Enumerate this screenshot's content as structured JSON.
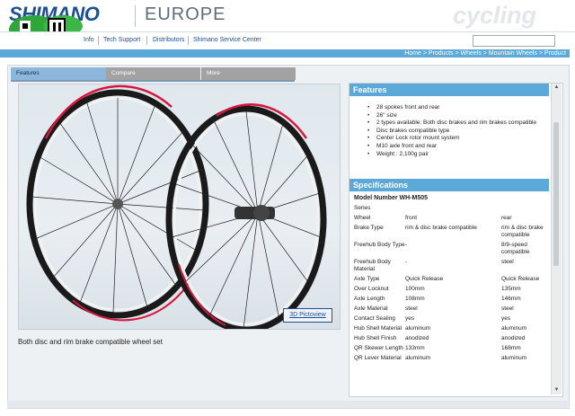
{
  "header": {
    "logo": "SHIMANO",
    "region": "EUROPE",
    "watermark": "cycling"
  },
  "nav": {
    "items": [
      "Info",
      "Tech Support",
      "Distributors",
      "Shimano Service Center"
    ],
    "search_placeholder": ""
  },
  "breadcrumb": "Home > Products > Wheels > Mountain Wheels > Product",
  "tabs": [
    {
      "label": "Features",
      "active": true
    },
    {
      "label": "Compare",
      "active": false
    },
    {
      "label": "More",
      "active": false
    }
  ],
  "image": {
    "pictoview_label": "3D Pictoview",
    "caption": "Both disc and rim brake compatible wheel set"
  },
  "features": {
    "title": "Features",
    "items": [
      "28 spokes front and rear",
      "26\" size",
      "2 types available: Both disc brakes and rim brakes compatible",
      "Disc brakes compatible type",
      "Center Lock rotor mount system",
      "M10 axle front and rear",
      "Weight : 2,100g pair"
    ]
  },
  "specifications": {
    "title": "Specifications",
    "model": "Model Number WH-M505",
    "rows": [
      [
        "Series",
        "",
        ""
      ],
      [
        "Wheel",
        "front",
        "rear"
      ],
      [
        "Brake Type",
        "rim & disc brake compatible",
        "rim & disc brake compatible"
      ],
      [
        "Freehub Body Type",
        "-",
        "8/9-speed compatible"
      ],
      [
        "Freehub Body Material",
        "-",
        "steel"
      ],
      [
        "Axle Type",
        "Quick Release",
        "Quick Release"
      ],
      [
        "Over Locknut",
        "100mm",
        "135mm"
      ],
      [
        "Axle Length",
        "108mm",
        "146mm"
      ],
      [
        "Axle Material",
        "steel",
        "steel"
      ],
      [
        "Contact Sealing",
        "yes",
        "yes"
      ],
      [
        "Hub Shell Material",
        "aluminum",
        "aluminum"
      ],
      [
        "Hub Shell Finish",
        "anodized",
        "anodized"
      ],
      [
        "QR Skewer Length",
        "133mm",
        "168mm"
      ],
      [
        "QR Lever Material",
        "aluminum",
        "aluminum"
      ]
    ]
  },
  "colors": {
    "brand_blue": "#1b4f93",
    "accent_blue": "#5aa9d8",
    "rim_red": "#d8163c"
  }
}
